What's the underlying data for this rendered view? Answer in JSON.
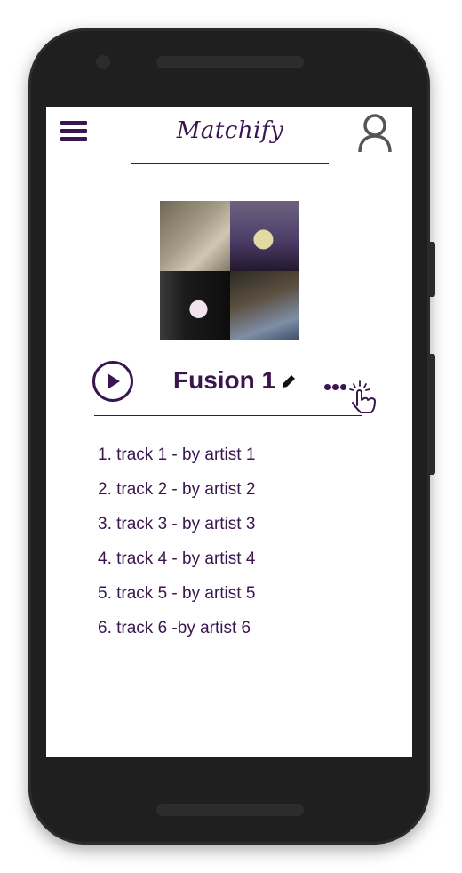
{
  "app": {
    "brand_name": "Matchify"
  },
  "playlist": {
    "title": "Fusion 1",
    "tracks": [
      "1. track 1 - by artist 1",
      "2. track 2 - by artist 2",
      "3. track 3 - by artist 3",
      "4. track 4 - by artist 4",
      "5. track 5 - by artist 5",
      "6. track 6 -by artist 6"
    ]
  },
  "icons": {
    "menu": "hamburger-menu-icon",
    "profile": "user-profile-icon",
    "play": "play-icon",
    "edit": "pencil-icon",
    "more": "more-dots-icon",
    "tap": "tap-gesture-icon"
  },
  "colors": {
    "accent": "#3a1650",
    "phone_frame": "#1f1f1f",
    "screen_background": "#ffffff"
  }
}
